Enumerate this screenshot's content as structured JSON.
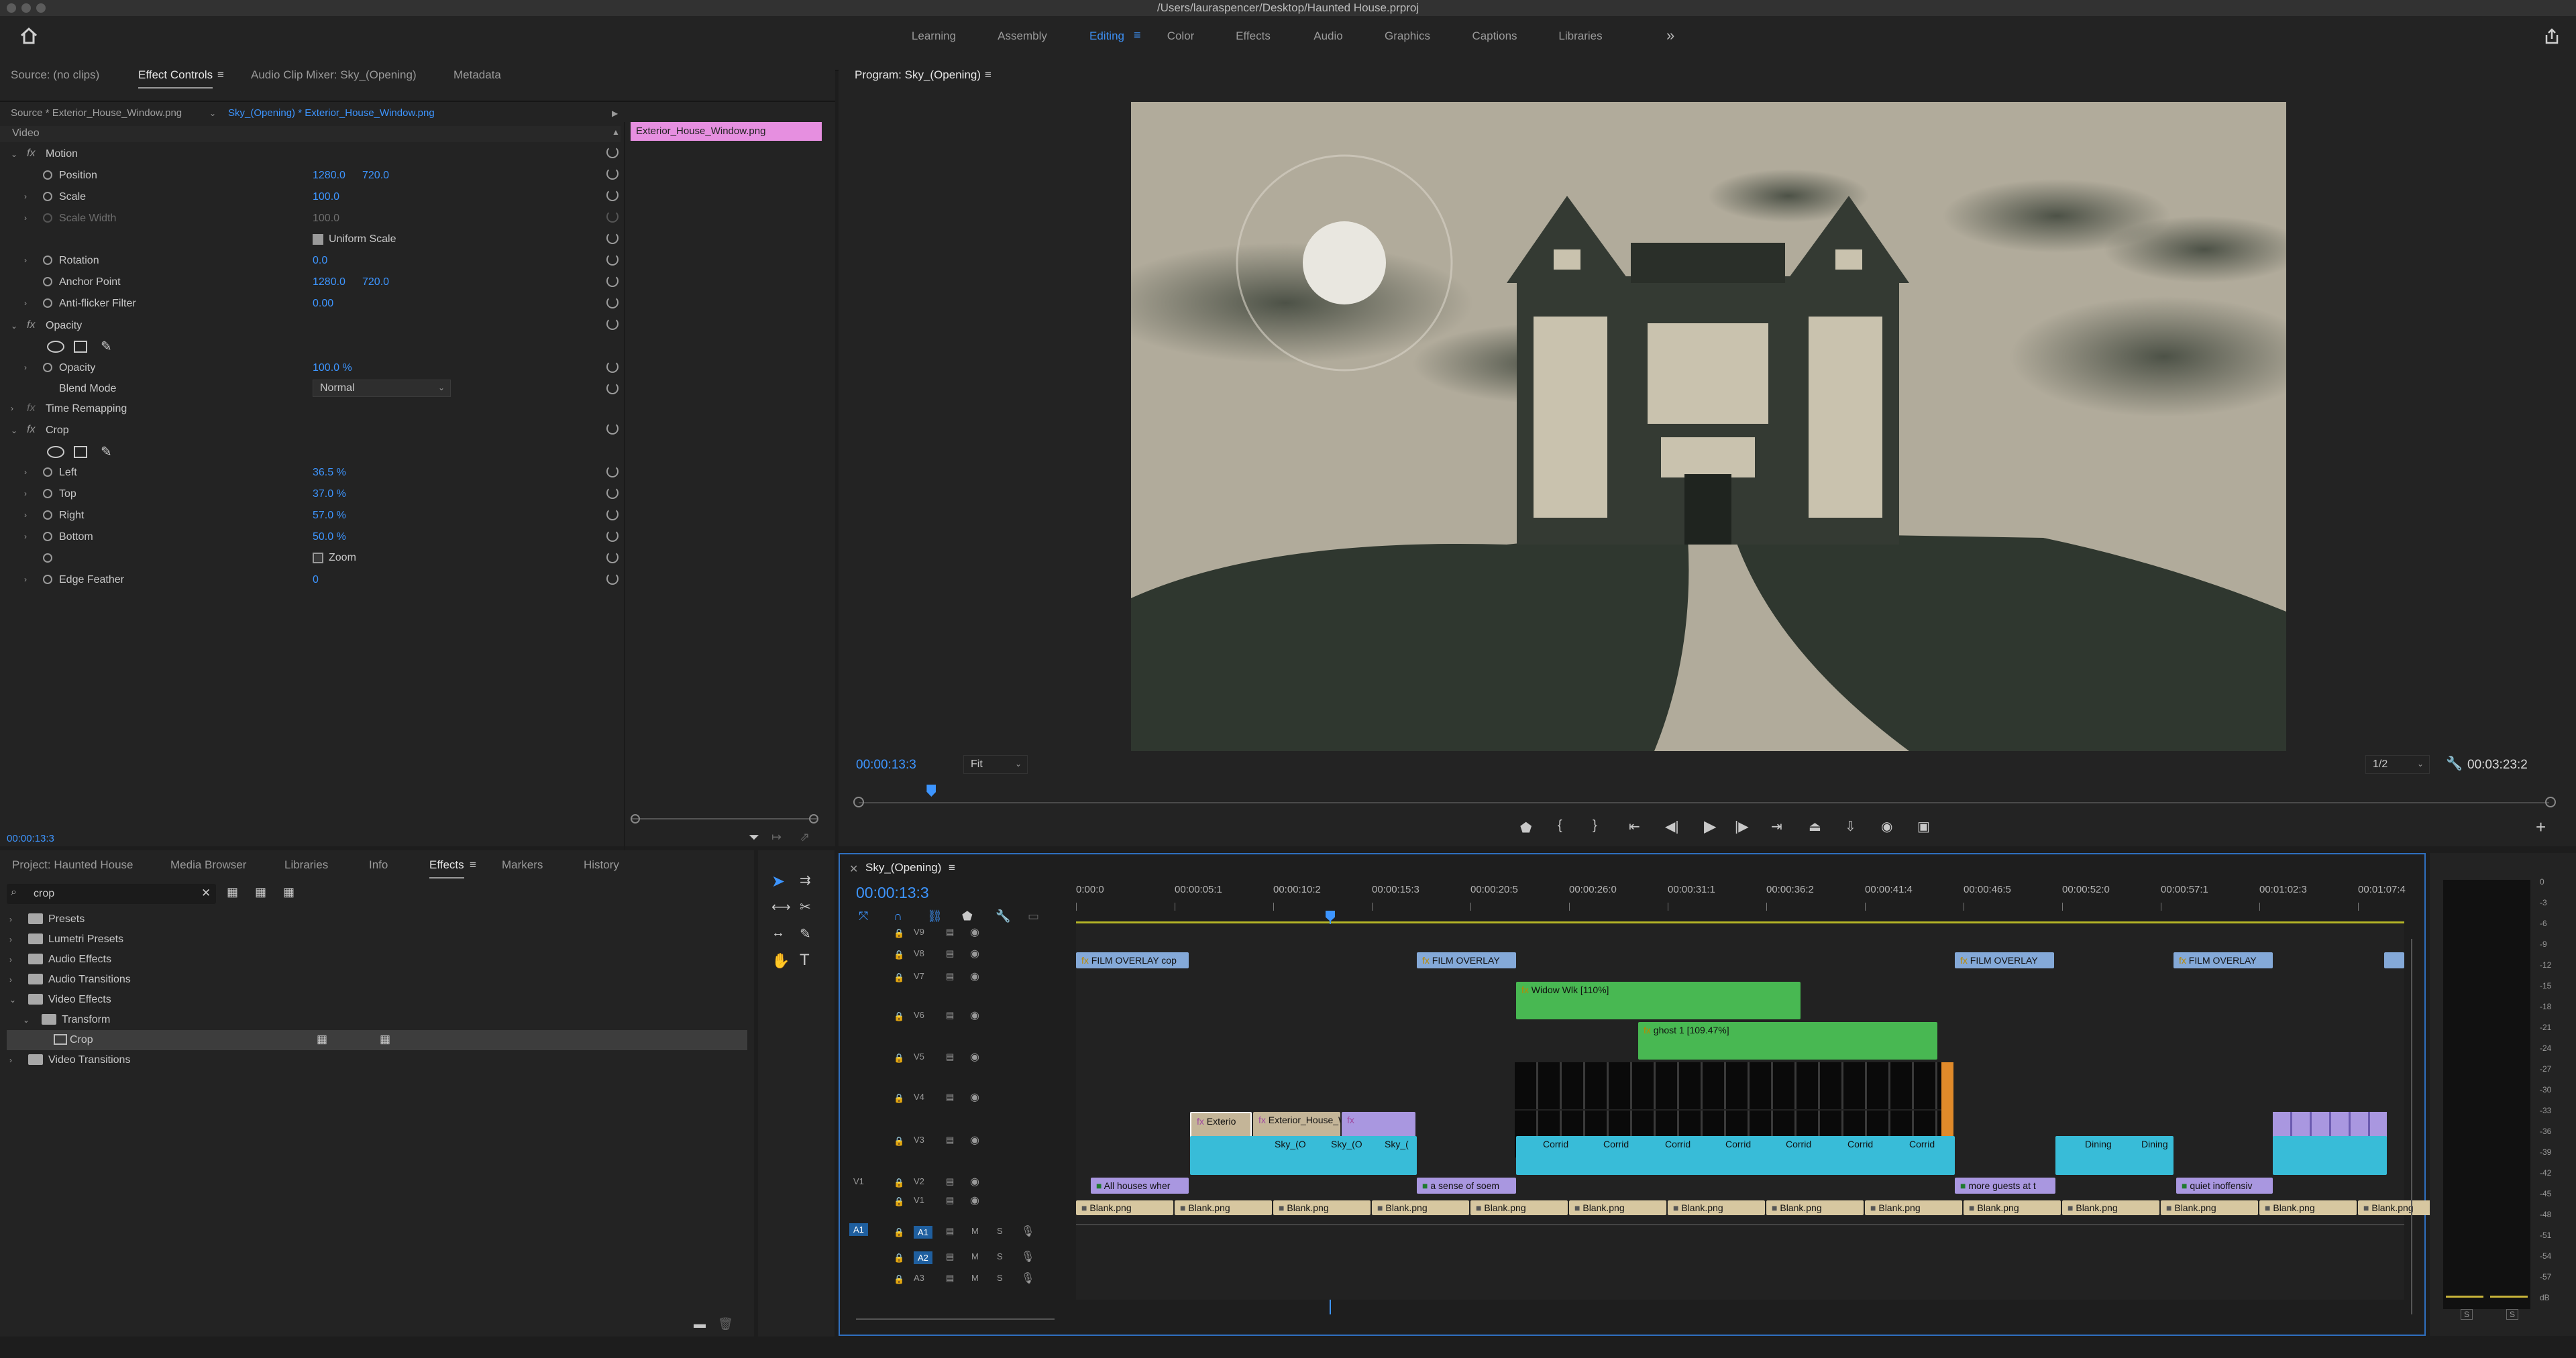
{
  "window": {
    "title": "/Users/lauraspencer/Desktop/Haunted House.prproj"
  },
  "workspaces": [
    {
      "label": "Learning"
    },
    {
      "label": "Assembly"
    },
    {
      "label": "Editing",
      "active": true
    },
    {
      "label": "Color"
    },
    {
      "label": "Effects"
    },
    {
      "label": "Audio"
    },
    {
      "label": "Graphics"
    },
    {
      "label": "Captions"
    },
    {
      "label": "Libraries"
    }
  ],
  "source_panel": {
    "tabs": [
      "Source: (no clips)",
      "Effect Controls",
      "Audio Clip Mixer: Sky_(Opening)",
      "Metadata"
    ],
    "clip_path": "Source * Exterior_House_Window.png",
    "sequence_path": "Sky_(Opening) * Exterior_House_Window.png",
    "clip_label": "Exterior_House_Window.png",
    "section": "Video",
    "motion": {
      "title": "Motion",
      "position": {
        "label": "Position",
        "x": "1280.0",
        "y": "720.0"
      },
      "scale": {
        "label": "Scale",
        "value": "100.0"
      },
      "scale_width": {
        "label": "Scale Width",
        "value": "100.0"
      },
      "uniform_scale": "Uniform Scale",
      "rotation": {
        "label": "Rotation",
        "value": "0.0"
      },
      "anchor": {
        "label": "Anchor Point",
        "x": "1280.0",
        "y": "720.0"
      },
      "antiflicker": {
        "label": "Anti-flicker Filter",
        "value": "0.00"
      }
    },
    "opacity": {
      "title": "Opacity",
      "label": "Opacity",
      "value": "100.0 %",
      "blend_label": "Blend Mode",
      "blend_value": "Normal"
    },
    "time_remap": "Time Remapping",
    "crop": {
      "title": "Crop",
      "left": {
        "label": "Left",
        "value": "36.5 %"
      },
      "top": {
        "label": "Top",
        "value": "37.0 %"
      },
      "right": {
        "label": "Right",
        "value": "57.0 %"
      },
      "bottom": {
        "label": "Bottom",
        "value": "50.0 %"
      },
      "zoom": "Zoom",
      "feather": {
        "label": "Edge Feather",
        "value": "0"
      }
    },
    "timecode": "00:00:13:3"
  },
  "program": {
    "title": "Program: Sky_(Opening)",
    "timecode": "00:00:13:3",
    "fit": "Fit",
    "quality": "1/2",
    "duration": "00:03:23:2",
    "playhead_fraction": 0.043
  },
  "project_panel": {
    "tabs": [
      "Project: Haunted House",
      "Media Browser",
      "Libraries",
      "Info",
      "Effects",
      "Markers",
      "History"
    ],
    "search_value": "crop",
    "items": [
      {
        "label": "Presets"
      },
      {
        "label": "Lumetri Presets"
      },
      {
        "label": "Audio Effects"
      },
      {
        "label": "Audio Transitions"
      },
      {
        "label": "Video Effects"
      },
      {
        "label": "Transform"
      },
      {
        "label": "Crop"
      },
      {
        "label": "Video Transitions"
      }
    ]
  },
  "timeline": {
    "title": "Sky_(Opening)",
    "timecode": "00:00:13:3",
    "ruler": [
      "0:00:0",
      "00:00:05:1",
      "00:00:10:2",
      "00:00:15:3",
      "00:00:20:5",
      "00:00:26:0",
      "00:00:31:1",
      "00:00:36:2",
      "00:00:41:4",
      "00:00:46:5",
      "00:00:52:0",
      "00:00:57:1",
      "00:01:02:3",
      "00:01:07:4"
    ],
    "tracks": [
      "V9",
      "V8",
      "V7",
      "V6",
      "V5",
      "V4",
      "V3",
      "V2",
      "V1",
      "A1",
      "A2",
      "A3"
    ],
    "src_tracks": {
      "v": "V1",
      "a": "A1"
    },
    "clips": {
      "film1": "FILM OVERLAY cop",
      "film2": "FILM OVERLAY",
      "film3": "FILM OVERLAY",
      "film4": "FILM OVERLAY",
      "widow": "Widow Wlk [110%]",
      "ghost": "ghost 1 [109.47%]",
      "ext1": "Exterio",
      "ext2": "Exterior_House_Win",
      "sky1": "Sky_(O",
      "sky2": "Sky_(O",
      "sky3": "Sky_(",
      "corr1": "Corrid",
      "corr2": "Corrid",
      "corr3": "Corrid",
      "corr4": "Corrid",
      "corr5": "Corrid",
      "corr6": "Corrid",
      "corr7": "Corrid",
      "din1": "Dining",
      "din2": "Dining",
      "v2a": "All houses wher",
      "v2b": "a sense of soem",
      "v2c": "more guests at t",
      "v2d": "quiet inoffensiv",
      "blank": "Blank.png"
    }
  },
  "meters": {
    "scale": [
      "0",
      "-3",
      "-6",
      "-9",
      "-12",
      "-15",
      "-18",
      "-21",
      "-24",
      "-27",
      "-30",
      "-33",
      "-36",
      "-39",
      "-42",
      "-45",
      "-48",
      "-51",
      "-54",
      "-57",
      "dB"
    ],
    "solo": "S"
  }
}
